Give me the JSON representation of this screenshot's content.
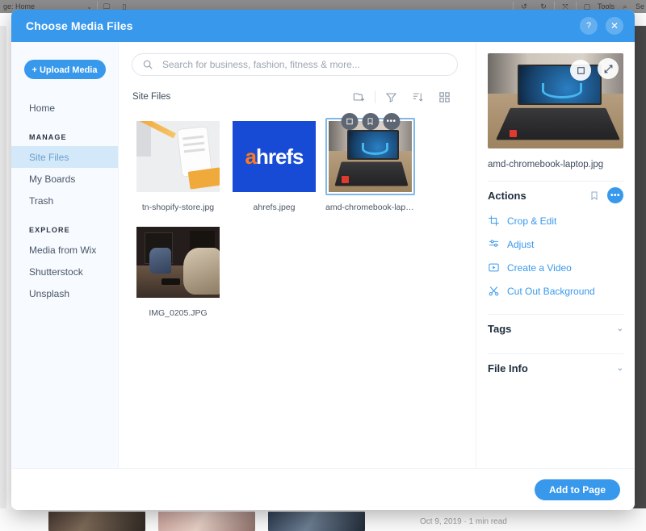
{
  "background": {
    "page_selector_label": "ge: Home",
    "tools_label": "Tools",
    "search_label": "Se",
    "post_meta": "Oct 9, 2019  ·  1 min read"
  },
  "header": {
    "title": "Choose Media Files",
    "help_label": "?",
    "close_label": "✕",
    "accent_color": "#3899ec"
  },
  "sidebar": {
    "upload_label": "+ Upload Media",
    "home_label": "Home",
    "manage_group": "MANAGE",
    "explore_group": "EXPLORE",
    "manage_items": [
      {
        "label": "Site Files"
      },
      {
        "label": "My Boards"
      },
      {
        "label": "Trash"
      }
    ],
    "explore_items": [
      {
        "label": "Media from Wix"
      },
      {
        "label": "Shutterstock"
      },
      {
        "label": "Unsplash"
      }
    ],
    "selected": "Site Files"
  },
  "search": {
    "placeholder": "Search for business, fashion, fitness & more...",
    "value": ""
  },
  "toolbar": {
    "breadcrumb": "Site Files",
    "buttons": [
      {
        "name": "new-folder",
        "title": "New Folder"
      },
      {
        "name": "filter",
        "title": "Filter"
      },
      {
        "name": "sort",
        "title": "Sort"
      },
      {
        "name": "view-grid",
        "title": "View"
      }
    ]
  },
  "files": [
    {
      "name": "tn-shopify-store.jpg",
      "art": "art-shopify",
      "selected": false
    },
    {
      "name": "ahrefs.jpeg",
      "art": "art-ahrefs",
      "selected": false
    },
    {
      "name": "amd-chromebook-laptop....",
      "art": "art-laptop",
      "selected": true
    },
    {
      "name": "IMG_0205.JPG",
      "art": "art-studio",
      "selected": false
    }
  ],
  "tile_hover": {
    "crop_label": "crop-icon",
    "bookmark_label": "bookmark-icon",
    "more_label": "•••"
  },
  "panel": {
    "file_name": "amd-chromebook-laptop.jpg",
    "actions_title": "Actions",
    "more_label": "•••",
    "actions": [
      {
        "label": "Crop & Edit",
        "icon": "crop-icon"
      },
      {
        "label": "Adjust",
        "icon": "sliders-icon"
      },
      {
        "label": "Create a Video",
        "icon": "video-icon"
      },
      {
        "label": "Cut Out Background",
        "icon": "scissors-icon"
      }
    ],
    "tags_title": "Tags",
    "file_info_title": "File Info",
    "chevron": "⌄"
  },
  "footer": {
    "add_label": "Add to Page"
  }
}
